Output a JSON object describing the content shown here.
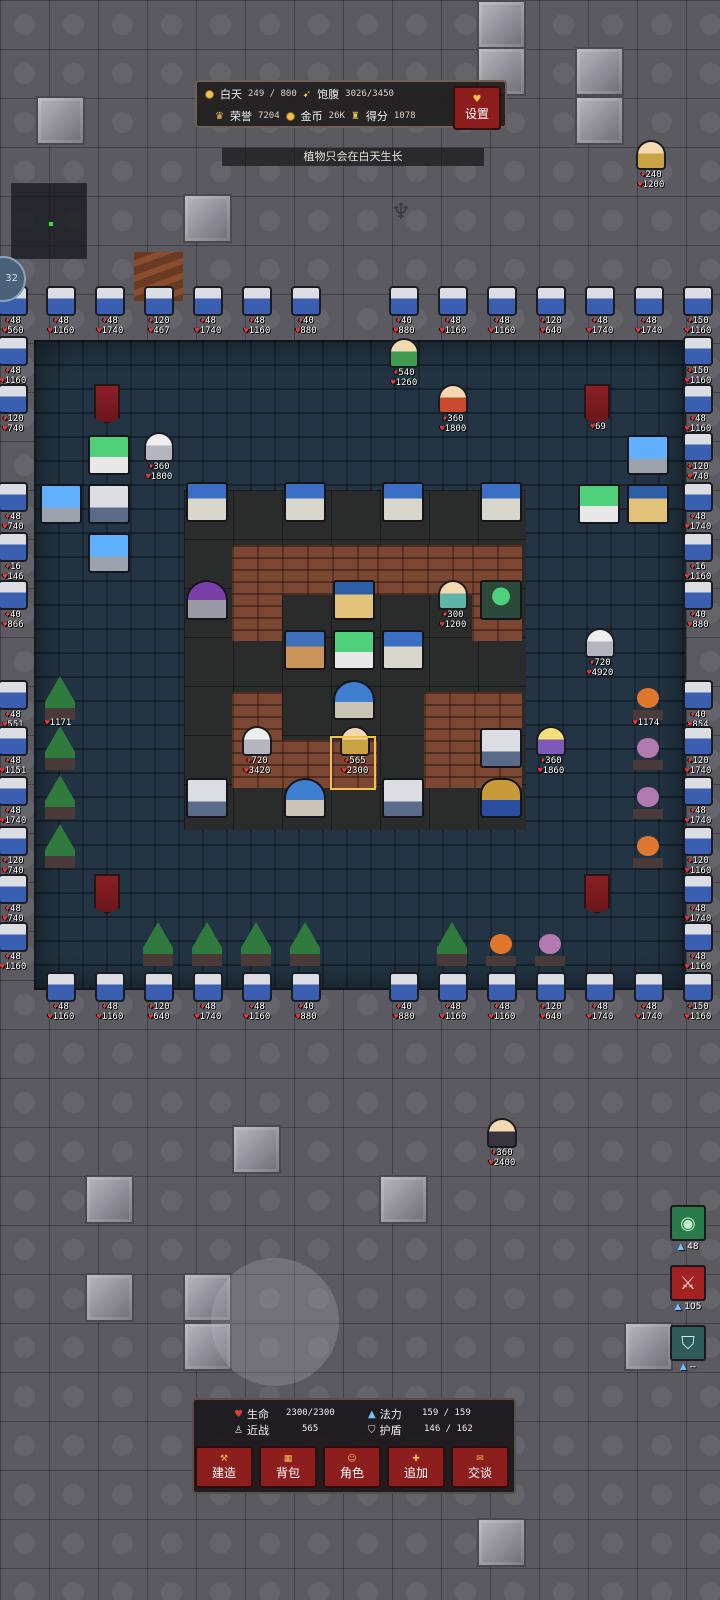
{
  "hud": {
    "day_label": "白天",
    "day_value": "249 / 800",
    "satiety_label": "饱腹",
    "satiety_value": "3026/3450",
    "honor_label": "荣誉",
    "honor_value": "7204",
    "gold_label": "金币",
    "gold_value": "26K",
    "score_label": "得分",
    "score_value": "1078",
    "settings_label": "设置",
    "hint": "植物只会在白天生长",
    "edge_avatar_text": "32"
  },
  "units": [
    {
      "name": "guard-top-1",
      "hp": "48",
      "max": "1160"
    },
    {
      "name": "guard-top-2",
      "hp": "48",
      "max": "1740"
    },
    {
      "name": "guard-top-3",
      "hp": "120",
      "max": "467"
    },
    {
      "name": "guard-top-4",
      "hp": "48",
      "max": "1740"
    },
    {
      "name": "guard-top-5",
      "hp": "48",
      "max": "1160"
    },
    {
      "name": "guard-top-6",
      "hp": "40",
      "max": "880"
    },
    {
      "name": "guard-top-7",
      "hp": "40",
      "max": "880"
    },
    {
      "name": "guard-top-8",
      "hp": "48",
      "max": "1160"
    },
    {
      "name": "guard-top-9",
      "hp": "48",
      "max": "1160"
    },
    {
      "name": "guard-top-10",
      "hp": "120",
      "max": "640"
    },
    {
      "name": "guard-top-11",
      "hp": "48",
      "max": "1740"
    },
    {
      "name": "guard-top-12",
      "hp": "48",
      "max": "1740"
    },
    {
      "name": "guard-top-13",
      "hp": "150",
      "max": "1160"
    },
    {
      "name": "angel-hero",
      "hp": "240",
      "max": "1200"
    },
    {
      "name": "green-hero",
      "hp": "540",
      "max": "1260"
    },
    {
      "name": "red-hero",
      "hp": "360",
      "max": "1800"
    },
    {
      "name": "white-beast",
      "hp": "360",
      "max": "1800"
    },
    {
      "name": "teal-hero",
      "hp": "300",
      "max": "1200"
    },
    {
      "name": "wolf-hero",
      "hp": "720",
      "max": "4920"
    },
    {
      "name": "white-hero",
      "hp": "720",
      "max": "3420"
    },
    {
      "name": "player-hero",
      "hp": "565",
      "max": "2300"
    },
    {
      "name": "mage-hero",
      "hp": "360",
      "max": "1860"
    },
    {
      "name": "dark-hero",
      "hp": "360",
      "max": "2400"
    },
    {
      "name": "guard-bottom-1",
      "hp": "48",
      "max": "1160"
    },
    {
      "name": "guard-bottom-2",
      "hp": "48",
      "max": "1160"
    },
    {
      "name": "guard-bottom-3",
      "hp": "120",
      "max": "640"
    },
    {
      "name": "guard-bottom-4",
      "hp": "48",
      "max": "1740"
    },
    {
      "name": "guard-bottom-5",
      "hp": "48",
      "max": "1160"
    },
    {
      "name": "guard-bottom-6",
      "hp": "40",
      "max": "880"
    },
    {
      "name": "guard-bottom-7",
      "hp": "40",
      "max": "880"
    },
    {
      "name": "guard-bottom-8",
      "hp": "48",
      "max": "1160"
    },
    {
      "name": "guard-bottom-9",
      "hp": "48",
      "max": "1160"
    },
    {
      "name": "guard-bottom-10",
      "hp": "120",
      "max": "640"
    },
    {
      "name": "guard-bottom-11",
      "hp": "48",
      "max": "1740"
    },
    {
      "name": "guard-bottom-12",
      "hp": "48",
      "max": "1740"
    },
    {
      "name": "guard-bottom-13",
      "hp": "150",
      "max": "1160"
    }
  ],
  "structures": {
    "banner_hp": "69",
    "tree_left_hp": "1171",
    "pumpkin_right_hp": "1174"
  },
  "side_guards": [
    {
      "name": "side-left-1",
      "hp": "48",
      "max": "560"
    },
    {
      "name": "side-left-2",
      "hp": "48",
      "max": "1160"
    },
    {
      "name": "side-left-3",
      "hp": "120",
      "max": "740"
    },
    {
      "name": "side-left-4",
      "hp": "48",
      "max": "740"
    },
    {
      "name": "side-left-5",
      "hp": "16",
      "max": "146"
    },
    {
      "name": "side-left-6",
      "hp": "40",
      "max": "866"
    },
    {
      "name": "side-left-7",
      "hp": "48",
      "max": "551"
    },
    {
      "name": "side-left-8",
      "hp": "48",
      "max": "1151"
    },
    {
      "name": "side-left-9",
      "hp": "48",
      "max": "1740"
    },
    {
      "name": "side-left-10",
      "hp": "120",
      "max": "740"
    },
    {
      "name": "side-left-11",
      "hp": "48",
      "max": "740"
    },
    {
      "name": "side-left-12",
      "hp": "48",
      "max": "1160"
    },
    {
      "name": "side-right-1",
      "hp": "150",
      "max": "1160"
    },
    {
      "name": "side-right-2",
      "hp": "48",
      "max": "1160"
    },
    {
      "name": "side-right-3",
      "hp": "120",
      "max": "740"
    },
    {
      "name": "side-right-4",
      "hp": "48",
      "max": "1740"
    },
    {
      "name": "side-right-5",
      "hp": "16",
      "max": "1160"
    },
    {
      "name": "side-right-6",
      "hp": "40",
      "max": "880"
    },
    {
      "name": "side-right-7",
      "hp": "40",
      "max": "854"
    },
    {
      "name": "side-right-8",
      "hp": "120",
      "max": "1740"
    },
    {
      "name": "side-right-9",
      "hp": "48",
      "max": "1740"
    },
    {
      "name": "side-right-10",
      "hp": "120",
      "max": "1160"
    },
    {
      "name": "side-right-11",
      "hp": "48",
      "max": "1740"
    },
    {
      "name": "side-right-12",
      "hp": "48",
      "max": "1160"
    }
  ],
  "skills": [
    {
      "name": "vision-skill",
      "icon": "eye-icon",
      "cost": "48"
    },
    {
      "name": "blade-skill",
      "icon": "sword-icon",
      "cost": "105"
    },
    {
      "name": "shield-skill",
      "icon": "shield-icon",
      "cost": "--"
    }
  ],
  "player": {
    "hp_label": "生命",
    "hp_value": "2300/2300",
    "mana_label": "法力",
    "mana_value": "159 / 159",
    "melee_label": "近战",
    "melee_value": "565",
    "shield_label": "护盾",
    "shield_value": "146 / 162"
  },
  "menu": {
    "build": "建造",
    "bag": "背包",
    "character": "角色",
    "add": "追加",
    "talk": "交谈"
  },
  "colors": {
    "accent_red": "#8d1e1e",
    "mana_blue": "#6fc3ff",
    "hp_red": "#e23b3b",
    "gold": "#f1c24a",
    "selected_outline": "#f1c24a"
  }
}
